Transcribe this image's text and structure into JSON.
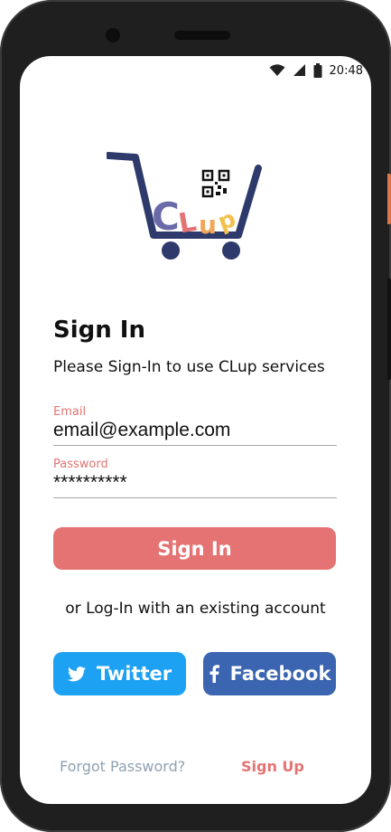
{
  "status_bar": {
    "time": "20:48",
    "wifi_icon": "wifi-icon",
    "signal_icon": "cell-signal-icon",
    "battery_icon": "battery-icon"
  },
  "logo": {
    "text": "CLup",
    "icon": "shopping-cart-qr-icon"
  },
  "header": {
    "title": "Sign In",
    "subtitle": "Please Sign-In to use CLup services"
  },
  "form": {
    "email": {
      "label": "Email",
      "value": "email@example.com"
    },
    "password": {
      "label": "Password",
      "value": "**********"
    },
    "submit_label": "Sign In"
  },
  "social": {
    "prompt": "or Log-In with an existing account",
    "twitter_label": "Twitter",
    "facebook_label": "Facebook"
  },
  "footer": {
    "forgot_label": "Forgot Password?",
    "signup_label": "Sign Up"
  },
  "colors": {
    "accent": "#e57373",
    "twitter": "#1da1f2",
    "facebook": "#3b65b0",
    "cart": "#2e3a6b"
  }
}
